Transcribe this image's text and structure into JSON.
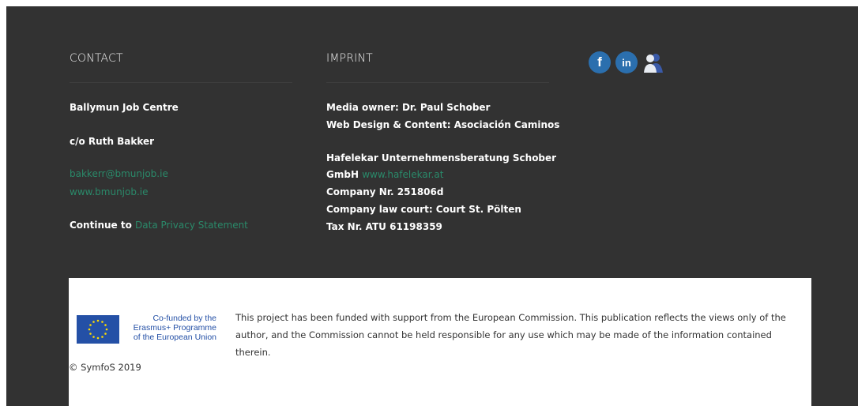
{
  "contact": {
    "heading": "CONTACT",
    "org": "Ballymun Job Centre",
    "co": "c/o Ruth Bakker",
    "email": "bakkerr@bmunjob.ie",
    "website": "www.bmunjob.ie",
    "continue_prefix": "Continue to",
    "privacy_link": "Data Privacy Statement"
  },
  "imprint": {
    "heading": "IMPRINT",
    "media_owner": "Media owner: Dr. Paul Schober",
    "web_design": "Web Design & Content: Asociación Caminos",
    "company_line1": "Hafelekar Unternehmensberatung Schober",
    "company_line2_prefix": "GmbH",
    "company_link": "www.hafelekar.at",
    "company_nr": "Company Nr. 251806d",
    "law_court": "Company law court: Court St. Pölten",
    "tax_nr": "Tax Nr. ATU 61198359"
  },
  "social": {
    "facebook_glyph": "f",
    "linkedin_glyph": "in",
    "icons": [
      "facebook-icon",
      "linkedin-icon",
      "people-icon"
    ]
  },
  "eu": {
    "line1": "Co-funded by the",
    "line2": "Erasmus+ Programme",
    "line3": "of the European Union"
  },
  "disclaimer": "This project has been funded with support from the European Commission. This publication reflects the views only of the author, and the Commission cannot be held responsible for any use which may be made of the information contained therein.",
  "copyright": "© SymfoS 2019",
  "colors": {
    "footer_bg": "#323232",
    "link": "#2a8a6a",
    "social_blue": "#2b6fae",
    "eu_blue": "#2450a6",
    "eu_star": "#ffdd00"
  }
}
